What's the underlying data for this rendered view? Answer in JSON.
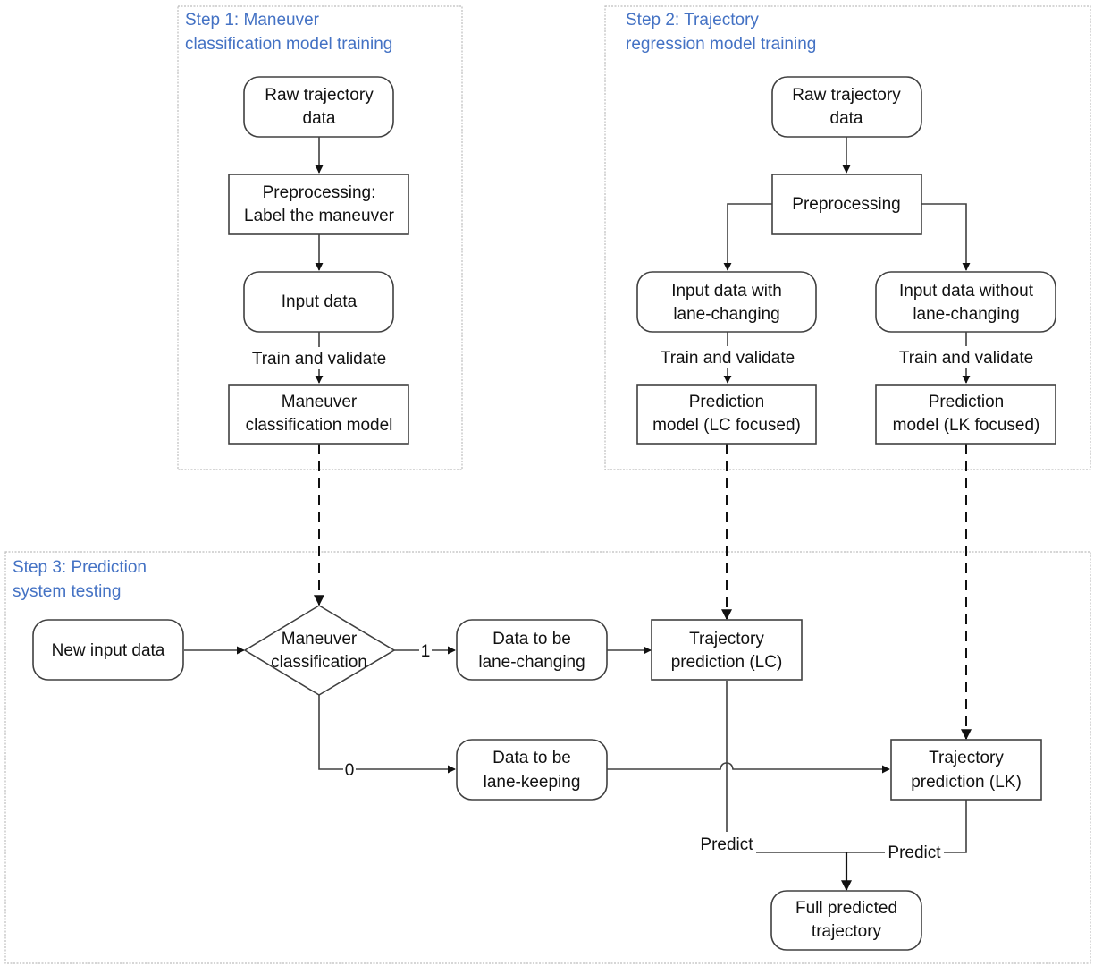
{
  "groups": {
    "step1": {
      "title_line1": "Step 1: Maneuver",
      "title_line2": "classification model training"
    },
    "step2": {
      "title_line1": "Step 2: Trajectory",
      "title_line2": "regression model training"
    },
    "step3": {
      "title_line1": "Step 3: Prediction",
      "title_line2": "system testing"
    }
  },
  "nodes": {
    "s1_raw": {
      "line1": "Raw trajectory",
      "line2": "data",
      "shape": "rounded"
    },
    "s1_pre": {
      "line1": "Preprocessing:",
      "line2": "Label the maneuver",
      "shape": "rect"
    },
    "s1_input": {
      "line1": "Input data",
      "shape": "rounded"
    },
    "s1_model": {
      "line1": "Maneuver",
      "line2": "classification model",
      "shape": "rect"
    },
    "s2_raw": {
      "line1": "Raw trajectory",
      "line2": "data",
      "shape": "rounded"
    },
    "s2_pre": {
      "line1": "Preprocessing",
      "shape": "rect"
    },
    "s2_input_lc": {
      "line1": "Input data with",
      "line2": "lane-changing",
      "shape": "rounded"
    },
    "s2_input_lk": {
      "line1": "Input data without",
      "line2": "lane-changing",
      "shape": "rounded"
    },
    "s2_model_lc": {
      "line1": "Prediction",
      "line2": "model (LC focused)",
      "shape": "rect"
    },
    "s2_model_lk": {
      "line1": "Prediction",
      "line2": "model (LK focused)",
      "shape": "rect"
    },
    "s3_new": {
      "line1": "New input data",
      "shape": "rounded"
    },
    "s3_decision": {
      "line1": "Maneuver",
      "line2": "classification",
      "shape": "diamond"
    },
    "s3_data_lc": {
      "line1": "Data to be",
      "line2": "lane-changing",
      "shape": "rounded"
    },
    "s3_data_lk": {
      "line1": "Data to be",
      "line2": "lane-keeping",
      "shape": "rounded"
    },
    "s3_traj_lc": {
      "line1": "Trajectory",
      "line2": "prediction (LC)",
      "shape": "rect"
    },
    "s3_traj_lk": {
      "line1": "Trajectory",
      "line2": "prediction (LK)",
      "shape": "rect"
    },
    "s3_full": {
      "line1": "Full predicted",
      "line2": "trajectory",
      "shape": "rounded"
    }
  },
  "edge_labels": {
    "s1_train": "Train and validate",
    "s2_train_lc": "Train and validate",
    "s2_train_lk": "Train and validate",
    "branch_1": "1",
    "branch_0": "0",
    "predict_lc": "Predict",
    "predict_lk": "Predict"
  },
  "colors": {
    "group_title": "#4472c4",
    "stroke": "#404040",
    "group_border": "#bdbdbd"
  }
}
